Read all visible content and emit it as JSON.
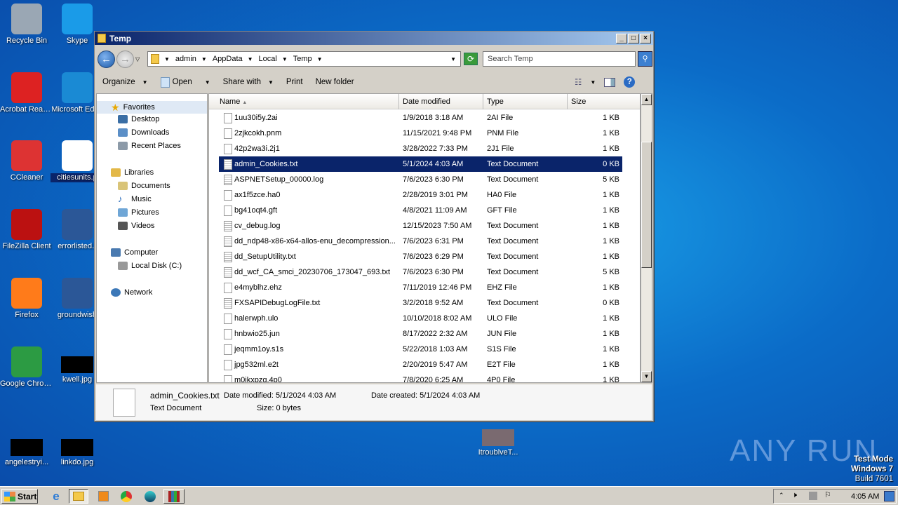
{
  "desktop": {
    "icons": [
      {
        "label": "Recycle Bin",
        "icon": "recycle-bin-icon",
        "color": "#9aa7b4"
      },
      {
        "label": "Skype",
        "icon": "skype-icon",
        "color": "#1a9be8"
      },
      {
        "label": "Acrobat Reader DC",
        "icon": "acrobat-icon",
        "color": "#d22"
      },
      {
        "label": "Microsoft Edge",
        "icon": "edge-icon",
        "color": "#1a8ad4"
      },
      {
        "label": "CCleaner",
        "icon": "ccleaner-icon",
        "color": "#d33"
      },
      {
        "label": "citiesunits.p",
        "icon": "file-icon",
        "color": "#fff"
      },
      {
        "label": "FileZilla Client",
        "icon": "filezilla-icon",
        "color": "#b11"
      },
      {
        "label": "errorlisted.r",
        "icon": "word-icon",
        "color": "#2b5797"
      },
      {
        "label": "Firefox",
        "icon": "firefox-icon",
        "color": "#ff7b1a"
      },
      {
        "label": "groundwish",
        "icon": "word-icon",
        "color": "#2b5797"
      },
      {
        "label": "Google Chrome",
        "icon": "chrome-icon",
        "color": "#2c9b43"
      },
      {
        "label": "kwell.jpg",
        "icon": "image-icon",
        "color": "#000"
      },
      {
        "label": "angelestryi...",
        "icon": "image-icon",
        "color": "#000"
      },
      {
        "label": "linkdo.jpg",
        "icon": "image-icon",
        "color": "#000"
      },
      {
        "label": "ItroublveT...",
        "icon": "image-icon",
        "color": "#7a6a70"
      }
    ]
  },
  "window": {
    "title": "Temp",
    "breadcrumb": [
      "admin",
      "AppData",
      "Local",
      "Temp"
    ],
    "search_placeholder": "Search Temp",
    "toolbar": {
      "organize": "Organize",
      "open": "Open",
      "share": "Share with",
      "print": "Print",
      "new_folder": "New folder"
    },
    "nav": {
      "favorites": "Favorites",
      "desktop": "Desktop",
      "downloads": "Downloads",
      "recent": "Recent Places",
      "libraries": "Libraries",
      "documents": "Documents",
      "music": "Music",
      "pictures": "Pictures",
      "videos": "Videos",
      "computer": "Computer",
      "local_disk": "Local Disk (C:)",
      "network": "Network"
    },
    "columns": {
      "name": "Name",
      "date": "Date modified",
      "type": "Type",
      "size": "Size"
    },
    "files": [
      {
        "name": "1uu30i5y.2ai",
        "date": "1/9/2018 3:18 AM",
        "type": "2AI File",
        "size": "1 KB"
      },
      {
        "name": "2zjkcokh.pnm",
        "date": "11/15/2021 9:48 PM",
        "type": "PNM File",
        "size": "1 KB"
      },
      {
        "name": "42p2wa3i.2j1",
        "date": "3/28/2022 7:33 PM",
        "type": "2J1 File",
        "size": "1 KB"
      },
      {
        "name": "admin_Cookies.txt",
        "date": "5/1/2024 4:03 AM",
        "type": "Text Document",
        "size": "0 KB",
        "selected": true
      },
      {
        "name": "ASPNETSetup_00000.log",
        "date": "7/6/2023 6:30 PM",
        "type": "Text Document",
        "size": "5 KB"
      },
      {
        "name": "ax1f5zce.ha0",
        "date": "2/28/2019 3:01 PM",
        "type": "HA0 File",
        "size": "1 KB"
      },
      {
        "name": "bg41oqt4.gft",
        "date": "4/8/2021 11:09 AM",
        "type": "GFT File",
        "size": "1 KB"
      },
      {
        "name": "cv_debug.log",
        "date": "12/15/2023 7:50 AM",
        "type": "Text Document",
        "size": "1 KB"
      },
      {
        "name": "dd_ndp48-x86-x64-allos-enu_decompression...",
        "date": "7/6/2023 6:31 PM",
        "type": "Text Document",
        "size": "1 KB"
      },
      {
        "name": "dd_SetupUtility.txt",
        "date": "7/6/2023 6:29 PM",
        "type": "Text Document",
        "size": "1 KB"
      },
      {
        "name": "dd_wcf_CA_smci_20230706_173047_693.txt",
        "date": "7/6/2023 6:30 PM",
        "type": "Text Document",
        "size": "5 KB"
      },
      {
        "name": "e4myblhz.ehz",
        "date": "7/11/2019 12:46 PM",
        "type": "EHZ File",
        "size": "1 KB"
      },
      {
        "name": "FXSAPIDebugLogFile.txt",
        "date": "3/2/2018 9:52 AM",
        "type": "Text Document",
        "size": "0 KB"
      },
      {
        "name": "halerwph.ulo",
        "date": "10/10/2018 8:02 AM",
        "type": "ULO File",
        "size": "1 KB"
      },
      {
        "name": "hnbwio25.jun",
        "date": "8/17/2022 2:32 AM",
        "type": "JUN File",
        "size": "1 KB"
      },
      {
        "name": "jeqmm1oy.s1s",
        "date": "5/22/2018 1:03 AM",
        "type": "S1S File",
        "size": "1 KB"
      },
      {
        "name": "jpg532ml.e2t",
        "date": "2/20/2019 5:47 AM",
        "type": "E2T File",
        "size": "1 KB"
      },
      {
        "name": "m0jkxpzq.4p0",
        "date": "7/8/2020 6:25 AM",
        "type": "4P0 File",
        "size": "1 KB"
      }
    ],
    "details": {
      "name": "admin_Cookies.txt",
      "type": "Text Document",
      "modified": "Date modified: 5/1/2024 4:03 AM",
      "size": "Size: 0 bytes",
      "created": "Date created: 5/1/2024 4:03 AM"
    }
  },
  "taskbar": {
    "start": "Start",
    "clock": "4:05 AM"
  },
  "watermark": {
    "text": "ANY RUN",
    "line1": "Test Mode",
    "line2": "Windows 7",
    "line3": "Build 7601"
  }
}
